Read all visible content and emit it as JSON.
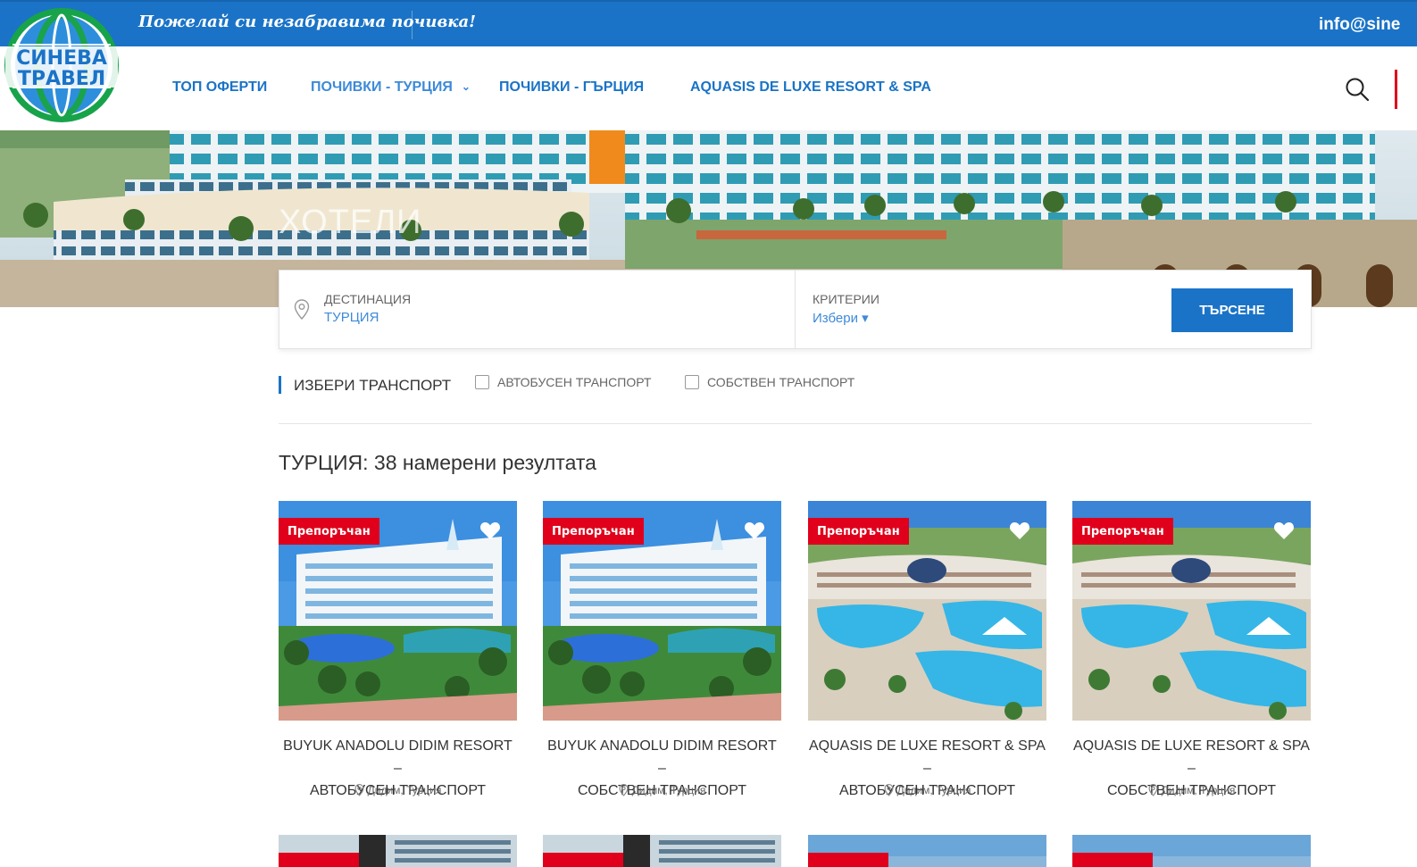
{
  "topbar": {
    "slogan": "Пожелай си незабравима почивка!",
    "email": "info@sine"
  },
  "logo": {
    "line1": "СИНЕВА",
    "line2": "ТРАВЕЛ"
  },
  "nav": {
    "items": [
      {
        "label": "ТОП ОФЕРТИ"
      },
      {
        "label": "ПОЧИВКИ - ТУРЦИЯ"
      },
      {
        "label": "ПОЧИВКИ - ГЪРЦИЯ"
      },
      {
        "label": "AQUASIS DE LUXE RESORT & SPA"
      }
    ]
  },
  "hero": {
    "title": "ХОТЕЛИ"
  },
  "search": {
    "destination_label": "ДЕСТИНАЦИЯ",
    "destination_value": "ТУРЦИЯ",
    "criteria_label": "КРИТЕРИИ",
    "criteria_value": "Избери ▾",
    "button": "ТЪРСЕНЕ"
  },
  "filter": {
    "title": "ИЗБЕРИ ТРАНСПОРТ",
    "options": [
      "АВТОБУСЕН ТРАНСПОРТ",
      "СОБСТВЕН ТРАНСПОРТ"
    ]
  },
  "results": {
    "title": "ТУРЦИЯ: 38 намерени резултата"
  },
  "cards": [
    {
      "badge": "Препоръчан",
      "name1": "BUYUK ANADOLU DIDIM RESORT –",
      "name2": "АВТОБУСЕН ТРАНСПОРТ",
      "location": "Дидим, Турция"
    },
    {
      "badge": "Препоръчан",
      "name1": "BUYUK ANADOLU DIDIM RESORT –",
      "name2": "СОБСТВЕН ТРАНСПОРТ",
      "location": "Дидим, Турция"
    },
    {
      "badge": "Препоръчан",
      "name1": "AQUASIS DE LUXE RESORT & SPA –",
      "name2": "АВТОБУСЕН ТРАНСПОРТ",
      "location": "Дидим, Турция"
    },
    {
      "badge": "Препоръчан",
      "name1": "AQUASIS DE LUXE RESORT & SPA –",
      "name2": "СОБСТВЕН ТРАНСПОРТ",
      "location": "Дидим, Турция"
    }
  ],
  "colors": {
    "brand_blue": "#1a73c7",
    "badge_red": "#e0001b"
  },
  "icons": [
    "search-icon",
    "location-pin-icon",
    "heart-icon",
    "chevron-down-icon",
    "checkbox-icon"
  ]
}
